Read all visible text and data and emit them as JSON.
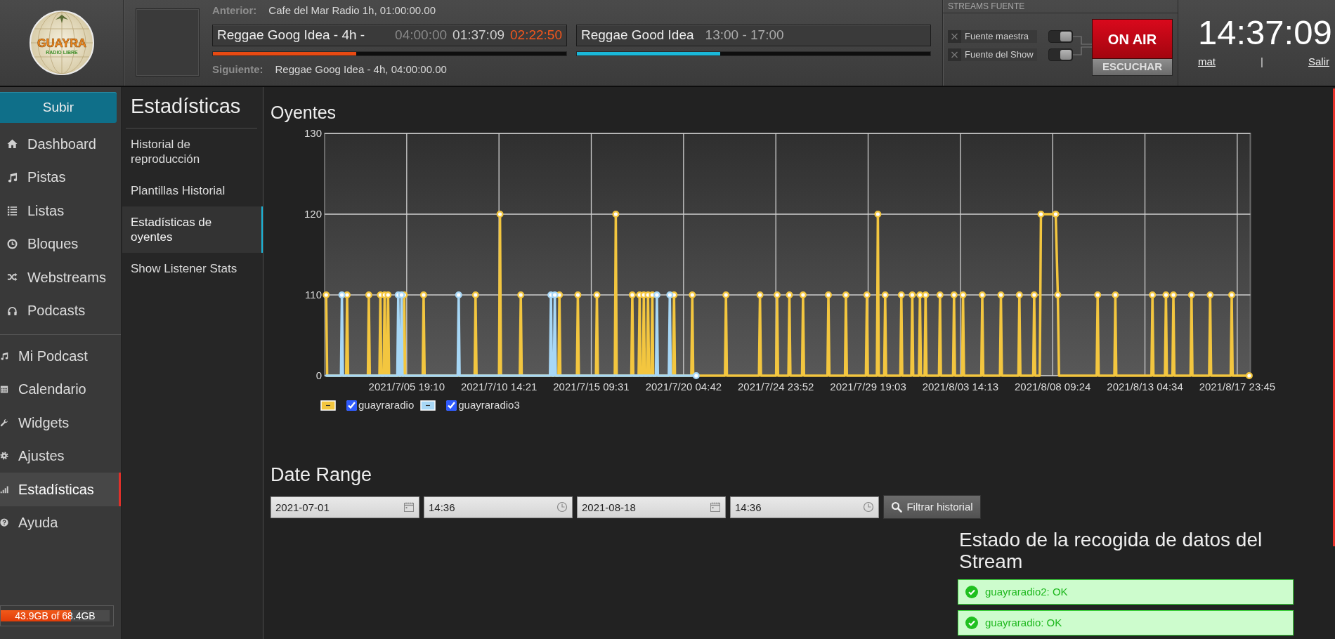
{
  "header": {
    "logo": {
      "name": "GUAYRA",
      "tagline": "RADIO LIBRE"
    },
    "previous": {
      "label": "Anterior:",
      "value": "Cafe del Mar Radio 1h, 01:00:00.00"
    },
    "current_track": {
      "title": "Reggae Goog Idea - 4h -",
      "duration": "04:00:00",
      "elapsed": "01:37:09",
      "remaining": "02:22:50",
      "level": 0.405
    },
    "current_show": {
      "title": "Reggae Good Idea",
      "time": "13:00 - 17:00",
      "level": 0.405
    },
    "next": {
      "label": "Siguiente:",
      "value": "Reggae Goog Idea - 4h, 04:00:00.00"
    },
    "stream_sources": {
      "title": "STREAMS FUENTE",
      "sources": [
        {
          "label": "Fuente maestra",
          "connected": false,
          "on": true
        },
        {
          "label": "Fuente del Show",
          "connected": false,
          "on": true
        }
      ],
      "on_air": {
        "label": "ON AIR",
        "on": true
      },
      "listen_button": "ESCUCHAR"
    },
    "clock": {
      "time": "14:37:09",
      "user": "mat",
      "separator": "|",
      "logout": "Salir"
    }
  },
  "sidebar": {
    "upload_button": "Subir",
    "sections": [
      {
        "items": [
          {
            "label": "Dashboard",
            "selected": false
          },
          {
            "label": "Pistas",
            "selected": false
          },
          {
            "label": "Listas",
            "selected": false
          },
          {
            "label": "Bloques",
            "selected": false
          },
          {
            "label": "Webstreams",
            "selected": false
          },
          {
            "label": "Podcasts",
            "selected": false
          }
        ]
      },
      {
        "items": [
          {
            "label": "Mi Podcast",
            "selected": false
          },
          {
            "label": "Calendario",
            "selected": false
          },
          {
            "label": "Widgets",
            "selected": false
          },
          {
            "label": "Ajustes",
            "selected": false
          },
          {
            "label": "Estadísticas",
            "selected": true
          },
          {
            "label": "Ayuda",
            "selected": false
          }
        ]
      }
    ],
    "storage": {
      "text": "43.9GB of 68.4GB",
      "level": 0.642
    }
  },
  "subnav": {
    "title": "Estadísticas",
    "items": [
      {
        "label": "Historial de reproducción",
        "selected": false
      },
      {
        "label": "Plantillas Historial",
        "selected": false
      },
      {
        "label": "Estadísticas de oyentes",
        "selected": true
      },
      {
        "label": "Show Listener Stats",
        "selected": false
      }
    ]
  },
  "listeners": {
    "title": "Oyentes",
    "chart": {
      "y_labels": [
        "130",
        "120",
        "110",
        "0"
      ],
      "x_labels": [
        "2021/7/05 19:10",
        "2021/7/10 14:21",
        "2021/7/15 09:31",
        "2021/7/20 04:42",
        "2021/7/24 23:52",
        "2021/7/29 19:03",
        "2021/8/03 14:13",
        "2021/8/08 09:24",
        "2021/8/13 04:34",
        "2021/8/17 23:45"
      ],
      "series": [
        {
          "name": "guayraradio",
          "color": "#f3c63f",
          "checked": true
        },
        {
          "name": "guayraradio3",
          "color": "#a7d7f6",
          "checked": true
        }
      ]
    }
  },
  "date_range": {
    "title": "Date Range",
    "fields": [
      {
        "kind": "date",
        "value": "2021-07-01"
      },
      {
        "kind": "time",
        "value": "14:36"
      },
      {
        "kind": "date",
        "value": "2021-08-18"
      },
      {
        "kind": "time",
        "value": "14:36"
      }
    ],
    "button": "Filtrar historial"
  },
  "stream_status": {
    "title": "Estado de la recogida de datos del Stream",
    "items": [
      {
        "text": "guayraradio2: OK",
        "ok": true
      },
      {
        "text": "guayraradio: OK",
        "ok": true
      }
    ]
  }
}
